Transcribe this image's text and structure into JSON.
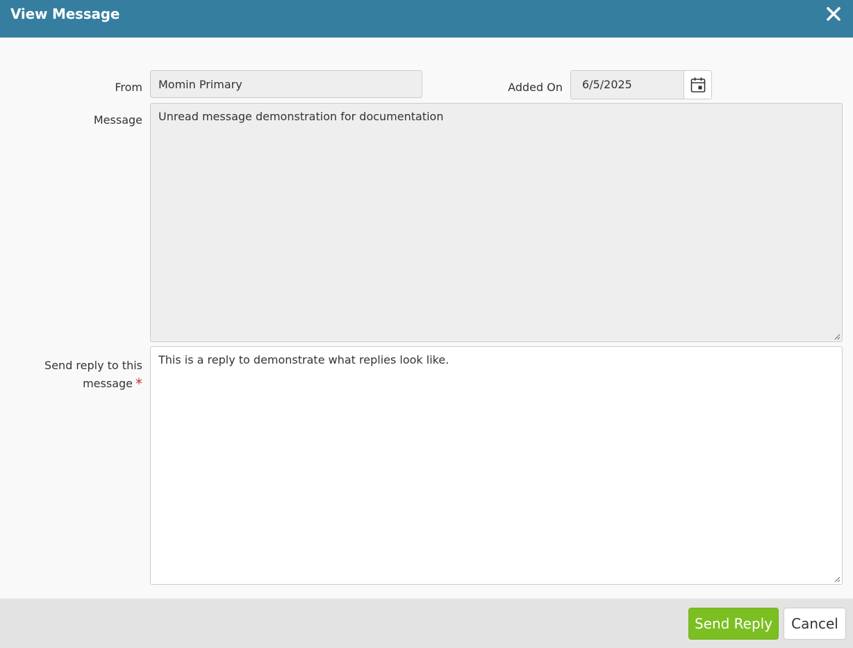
{
  "dialog": {
    "title": "View Message"
  },
  "form": {
    "from_label": "From",
    "from_value": "Momin Primary",
    "added_on_label": "Added On",
    "added_on_value": "6/5/2025",
    "message_label": "Message",
    "message_value": "Unread message demonstration for documentation",
    "reply_label_line1": "Send reply to this",
    "reply_label_line2": "message",
    "required_marker": "*",
    "reply_value": "This is a reply to demonstrate what replies look like."
  },
  "footer": {
    "send_label": "Send Reply",
    "cancel_label": "Cancel"
  },
  "icons": {
    "close": "close-icon",
    "calendar": "calendar-icon",
    "resize": "resize-grip-icon"
  },
  "colors": {
    "titlebar": "#367ea0",
    "send_button": "#7bbf22",
    "required": "#c0392b"
  }
}
